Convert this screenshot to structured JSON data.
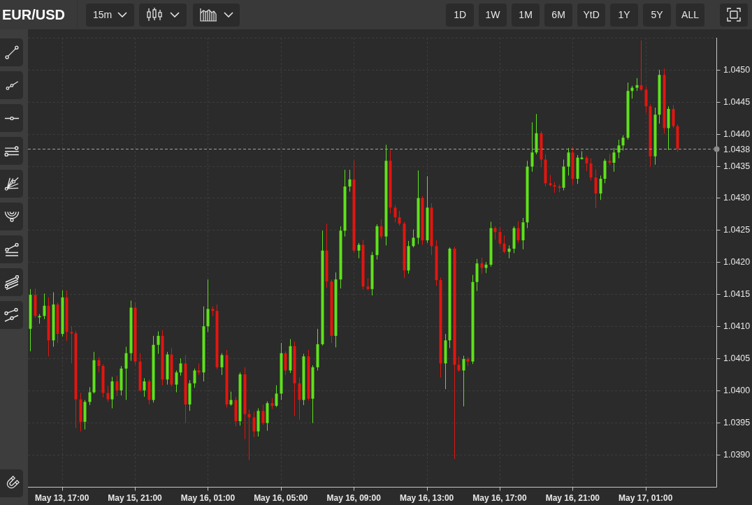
{
  "header": {
    "symbol": "EUR/USD",
    "interval": "15m",
    "ranges": [
      "1D",
      "1W",
      "1M",
      "6M",
      "YtD",
      "1Y",
      "5Y",
      "ALL"
    ]
  },
  "chart": {
    "chart_data": {
      "type": "candlestick",
      "categories": [
        null,
        null,
        null,
        null,
        null,
        null,
        null,
        "May 13, 17:00",
        null,
        null,
        null,
        null,
        null,
        null,
        null,
        null,
        null,
        null,
        null,
        null,
        null,
        null,
        null,
        "May 15, 21:00",
        null,
        null,
        null,
        null,
        null,
        null,
        null,
        null,
        null,
        null,
        null,
        null,
        null,
        null,
        null,
        "May 16, 01:00",
        null,
        null,
        null,
        null,
        null,
        null,
        null,
        null,
        null,
        null,
        null,
        null,
        null,
        null,
        null,
        "May 16, 05:00",
        null,
        null,
        null,
        null,
        null,
        null,
        null,
        null,
        null,
        null,
        null,
        null,
        null,
        null,
        null,
        "May 16, 09:00",
        null,
        null,
        null,
        null,
        null,
        null,
        null,
        null,
        null,
        null,
        null,
        null,
        null,
        null,
        null,
        "May 16, 13:00",
        null,
        null,
        null,
        null,
        null,
        null,
        null,
        null,
        null,
        null,
        null,
        null,
        null,
        null,
        null,
        "May 16, 17:00",
        null,
        null,
        null,
        null,
        null,
        null,
        null,
        null,
        null,
        null,
        null,
        null,
        null,
        null,
        null,
        "May 16, 21:00",
        null,
        null,
        null,
        null,
        null,
        null,
        null,
        null,
        null,
        null,
        null,
        null,
        null,
        null,
        null,
        "May 17, 01:00",
        null,
        null,
        null,
        null,
        null,
        null,
        null
      ],
      "ohlc": [
        [
          1.04096,
          1.04158,
          1.04061,
          1.04149
        ],
        [
          1.04149,
          1.04159,
          1.04113,
          1.04116
        ],
        [
          1.04116,
          1.04119,
          1.04104,
          1.04116
        ],
        [
          1.04116,
          1.04151,
          1.04111,
          1.04132
        ],
        [
          1.04132,
          1.04145,
          1.04053,
          1.04078
        ],
        [
          1.04078,
          1.04153,
          1.04068,
          1.04134
        ],
        [
          1.04134,
          1.04137,
          1.04074,
          1.04088
        ],
        [
          1.04088,
          1.04156,
          1.04084,
          1.04145
        ],
        [
          1.04145,
          1.04156,
          1.04077,
          1.04091
        ],
        [
          1.04091,
          1.041,
          1.04042,
          1.04089
        ],
        [
          1.04089,
          1.04093,
          1.03941,
          1.03986
        ],
        [
          1.03986,
          1.03996,
          1.03936,
          1.03951
        ],
        [
          1.03951,
          1.03985,
          1.03939,
          1.03982
        ],
        [
          1.03982,
          1.04005,
          1.03977,
          1.03997
        ],
        [
          1.03997,
          1.0406,
          1.03995,
          1.04047
        ],
        [
          1.04047,
          1.04052,
          1.04028,
          1.04038
        ],
        [
          1.04038,
          1.04041,
          1.03989,
          1.03996
        ],
        [
          1.03996,
          1.04007,
          1.03982,
          1.03986
        ],
        [
          1.03986,
          1.04021,
          1.03972,
          1.04014
        ],
        [
          1.04014,
          1.04023,
          1.03991,
          1.04
        ],
        [
          1.04,
          1.04038,
          1.03992,
          1.04034
        ],
        [
          1.04034,
          1.04068,
          1.03985,
          1.04058
        ],
        [
          1.04058,
          1.0414,
          1.04046,
          1.04129
        ],
        [
          1.04129,
          1.04137,
          1.0404,
          1.04045
        ],
        [
          1.04045,
          1.04058,
          1.03998,
          1.04
        ],
        [
          1.04,
          1.04019,
          1.0399,
          1.04014
        ],
        [
          1.04014,
          1.04017,
          1.03978,
          1.03985
        ],
        [
          1.03985,
          1.04085,
          1.03981,
          1.04071
        ],
        [
          1.04071,
          1.04092,
          1.04057,
          1.04085
        ],
        [
          1.04085,
          1.04094,
          1.04008,
          1.04017
        ],
        [
          1.04017,
          1.0406,
          1.04009,
          1.04056
        ],
        [
          1.04056,
          1.04066,
          1.04006,
          1.04009
        ],
        [
          1.04009,
          1.04031,
          1.03997,
          1.04028
        ],
        [
          1.04028,
          1.0405,
          1.04023,
          1.04042
        ],
        [
          1.04042,
          1.04055,
          1.03949,
          1.03978
        ],
        [
          1.03978,
          1.04016,
          1.03968,
          1.04011
        ],
        [
          1.04011,
          1.04034,
          1.04004,
          1.04031
        ],
        [
          1.04031,
          1.04042,
          1.04024,
          1.04028
        ],
        [
          1.04028,
          1.04131,
          1.04014,
          1.041
        ],
        [
          1.041,
          1.04173,
          1.04091,
          1.04127
        ],
        [
          1.04127,
          1.04131,
          1.04116,
          1.04124
        ],
        [
          1.04124,
          1.04134,
          1.04033,
          1.04036
        ],
        [
          1.04036,
          1.04058,
          1.04024,
          1.04055
        ],
        [
          1.04055,
          1.04063,
          1.03973,
          1.03978
        ],
        [
          1.03978,
          1.03998,
          1.03976,
          1.03985
        ],
        [
          1.03985,
          1.0399,
          1.03944,
          1.03952
        ],
        [
          1.03952,
          1.04028,
          1.03945,
          1.04025
        ],
        [
          1.04025,
          1.04036,
          1.03924,
          1.03963
        ],
        [
          1.03963,
          1.0397,
          1.03891,
          1.03958
        ],
        [
          1.03958,
          1.03967,
          1.03927,
          1.03936
        ],
        [
          1.03936,
          1.03972,
          1.03928,
          1.03968
        ],
        [
          1.03968,
          1.03978,
          1.03946,
          1.03949
        ],
        [
          1.03949,
          1.03983,
          1.03937,
          1.0398
        ],
        [
          1.0398,
          1.03988,
          1.03971,
          1.03976
        ],
        [
          1.03976,
          1.04008,
          1.03974,
          1.03995
        ],
        [
          1.03995,
          1.04074,
          1.03985,
          1.04058
        ],
        [
          1.04058,
          1.04061,
          1.04024,
          1.04031
        ],
        [
          1.04031,
          1.0408,
          1.04027,
          1.04069
        ],
        [
          1.04069,
          1.04076,
          1.0396,
          1.04011
        ],
        [
          1.04011,
          1.0402,
          1.03954,
          1.03985
        ],
        [
          1.03985,
          1.04057,
          1.03977,
          1.04053
        ],
        [
          1.04053,
          1.04063,
          1.03984,
          1.03987
        ],
        [
          1.03987,
          1.04039,
          1.03949,
          1.04036
        ],
        [
          1.04036,
          1.04096,
          1.04031,
          1.04072
        ],
        [
          1.04072,
          1.04249,
          1.0407,
          1.04218
        ],
        [
          1.04218,
          1.0426,
          1.0416,
          1.0417
        ],
        [
          1.0417,
          1.04173,
          1.04074,
          1.04085
        ],
        [
          1.04085,
          1.04184,
          1.04067,
          1.04173
        ],
        [
          1.04173,
          1.04256,
          1.04159,
          1.04249
        ],
        [
          1.04249,
          1.04344,
          1.0424,
          1.04318
        ],
        [
          1.04318,
          1.04344,
          1.0431,
          1.04329
        ],
        [
          1.04329,
          1.04358,
          1.04215,
          1.04218
        ],
        [
          1.04218,
          1.0423,
          1.04206,
          1.04227
        ],
        [
          1.04227,
          1.04235,
          1.04157,
          1.04162
        ],
        [
          1.04162,
          1.04175,
          1.04156,
          1.04158
        ],
        [
          1.04158,
          1.04216,
          1.04148,
          1.04211
        ],
        [
          1.04211,
          1.04259,
          1.04204,
          1.04256
        ],
        [
          1.04256,
          1.04267,
          1.04236,
          1.0424
        ],
        [
          1.0424,
          1.04383,
          1.04226,
          1.04358
        ],
        [
          1.04358,
          1.04375,
          1.04276,
          1.04285
        ],
        [
          1.04285,
          1.04289,
          1.04262,
          1.0427
        ],
        [
          1.0427,
          1.0428,
          1.04257,
          1.0426
        ],
        [
          1.0426,
          1.04263,
          1.04175,
          1.04187
        ],
        [
          1.04187,
          1.04233,
          1.04182,
          1.04225
        ],
        [
          1.04225,
          1.04251,
          1.04223,
          1.04238
        ],
        [
          1.04238,
          1.04343,
          1.04228,
          1.043
        ],
        [
          1.043,
          1.04303,
          1.04227,
          1.04234
        ],
        [
          1.04234,
          1.04334,
          1.0423,
          1.04285
        ],
        [
          1.04285,
          1.04292,
          1.04211,
          1.04225
        ],
        [
          1.04225,
          1.04234,
          1.04163,
          1.04172
        ],
        [
          1.04172,
          1.04176,
          1.0402,
          1.04042
        ],
        [
          1.04042,
          1.04088,
          1.04002,
          1.04078
        ],
        [
          1.04078,
          1.04223,
          1.04066,
          1.04221
        ],
        [
          1.04221,
          1.04224,
          1.03893,
          1.0404
        ],
        [
          1.0404,
          1.04053,
          1.04029,
          1.04031
        ],
        [
          1.04031,
          1.04054,
          1.03975,
          1.04049
        ],
        [
          1.04049,
          1.04052,
          1.04038,
          1.04045
        ],
        [
          1.04045,
          1.0418,
          1.04041,
          1.04169
        ],
        [
          1.04169,
          1.04205,
          1.04155,
          1.04198
        ],
        [
          1.04198,
          1.04207,
          1.04182,
          1.04191
        ],
        [
          1.04191,
          1.042,
          1.04183,
          1.04196
        ],
        [
          1.04196,
          1.04263,
          1.04193,
          1.04253
        ],
        [
          1.04253,
          1.04256,
          1.04235,
          1.04247
        ],
        [
          1.04247,
          1.04255,
          1.04224,
          1.04229
        ],
        [
          1.04229,
          1.04242,
          1.04214,
          1.04216
        ],
        [
          1.04216,
          1.04226,
          1.04206,
          1.04221
        ],
        [
          1.04221,
          1.04256,
          1.04214,
          1.04253
        ],
        [
          1.04253,
          1.04264,
          1.0423,
          1.04234
        ],
        [
          1.04234,
          1.04269,
          1.0422,
          1.04262
        ],
        [
          1.04262,
          1.04358,
          1.04253,
          1.04349
        ],
        [
          1.04349,
          1.04418,
          1.04341,
          1.04371
        ],
        [
          1.04371,
          1.04431,
          1.04368,
          1.04401
        ],
        [
          1.04401,
          1.04404,
          1.04348,
          1.0436
        ],
        [
          1.0436,
          1.04368,
          1.04318,
          1.04323
        ],
        [
          1.04323,
          1.04336,
          1.04318,
          1.0432
        ],
        [
          1.0432,
          1.04325,
          1.04308,
          1.04318
        ],
        [
          1.04318,
          1.04321,
          1.04309,
          1.04316
        ],
        [
          1.04316,
          1.0436,
          1.04312,
          1.04349
        ],
        [
          1.04349,
          1.04378,
          1.04335,
          1.04371
        ],
        [
          1.04371,
          1.0438,
          1.04321,
          1.0433
        ],
        [
          1.0433,
          1.04367,
          1.04322,
          1.04363
        ],
        [
          1.04363,
          1.04373,
          1.0436,
          1.04363
        ],
        [
          1.04363,
          1.04366,
          1.04342,
          1.04354
        ],
        [
          1.04354,
          1.04362,
          1.04327,
          1.04332
        ],
        [
          1.04332,
          1.04345,
          1.04284,
          1.04307
        ],
        [
          1.04307,
          1.04335,
          1.04297,
          1.0433
        ],
        [
          1.0433,
          1.04361,
          1.04323,
          1.04358
        ],
        [
          1.04358,
          1.04369,
          1.04351,
          1.04355
        ],
        [
          1.04355,
          1.04378,
          1.04341,
          1.04371
        ],
        [
          1.04371,
          1.04391,
          1.04362,
          1.04382
        ],
        [
          1.04382,
          1.04398,
          1.04374,
          1.04394
        ],
        [
          1.04394,
          1.0448,
          1.04391,
          1.04467
        ],
        [
          1.04467,
          1.04475,
          1.04455,
          1.04472
        ],
        [
          1.04472,
          1.04487,
          1.04467,
          1.04476
        ],
        [
          1.04476,
          1.04546,
          1.04467,
          1.04469
        ],
        [
          1.04469,
          1.04474,
          1.04433,
          1.04443
        ],
        [
          1.04443,
          1.04446,
          1.04349,
          1.04365
        ],
        [
          1.04365,
          1.04441,
          1.04352,
          1.0443
        ],
        [
          1.0443,
          1.045,
          1.04416,
          1.04492
        ],
        [
          1.04492,
          1.04502,
          1.044,
          1.04409
        ],
        [
          1.04409,
          1.04443,
          1.04375,
          1.04439
        ],
        [
          1.04439,
          1.04445,
          1.04409,
          1.04412
        ],
        [
          1.04412,
          1.04415,
          1.04372,
          1.04377
        ]
      ],
      "ylim": [
        1.03849,
        1.0455
      ],
      "yticks": [
        {
          "value": 1.045,
          "label": "1.0450"
        },
        {
          "value": 1.0445,
          "label": "1.0445"
        },
        {
          "value": 1.044,
          "label": "1.0440"
        },
        {
          "value": 1.0435,
          "label": "1.0435"
        },
        {
          "value": 1.043,
          "label": "1.0430"
        },
        {
          "value": 1.0425,
          "label": "1.0425"
        },
        {
          "value": 1.042,
          "label": "1.0420"
        },
        {
          "value": 1.0415,
          "label": "1.0415"
        },
        {
          "value": 1.041,
          "label": "1.0410"
        },
        {
          "value": 1.0405,
          "label": "1.0405"
        },
        {
          "value": 1.04,
          "label": "1.0400"
        },
        {
          "value": 1.0395,
          "label": "1.0395"
        },
        {
          "value": 1.039,
          "label": "1.0390"
        }
      ],
      "grid": true,
      "ref_lines": [
        {
          "axis": "y",
          "value": 1.04377,
          "label": "1.0438"
        }
      ]
    }
  }
}
